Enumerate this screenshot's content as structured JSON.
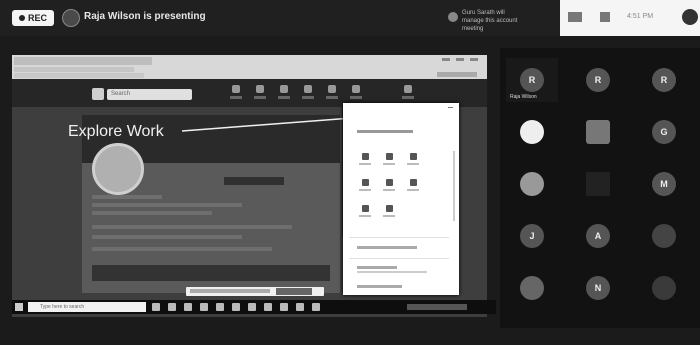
{
  "topbar": {
    "rec_label": "REC",
    "presenting_text": "Raja Wilson is presenting",
    "notice_text": "Guru Sarath will manage this account meeting"
  },
  "controls": {
    "time": "4:51 PM"
  },
  "screen": {
    "overlay_label": "Explore Work",
    "search_placeholder": "Search",
    "taskbar_search": "Type here to search"
  },
  "gallery": {
    "active_speaker_name": "Raja Wilson",
    "tiles": [
      {
        "initial": "R"
      },
      {
        "initial": "R"
      },
      {
        "initial": "R"
      },
      {
        "initial": ""
      },
      {
        "initial": ""
      },
      {
        "initial": "G"
      },
      {
        "initial": ""
      },
      {
        "initial": ""
      },
      {
        "initial": "M"
      },
      {
        "initial": "J"
      },
      {
        "initial": "A"
      },
      {
        "initial": ""
      },
      {
        "initial": ""
      },
      {
        "initial": "N"
      },
      {
        "initial": ""
      }
    ]
  }
}
